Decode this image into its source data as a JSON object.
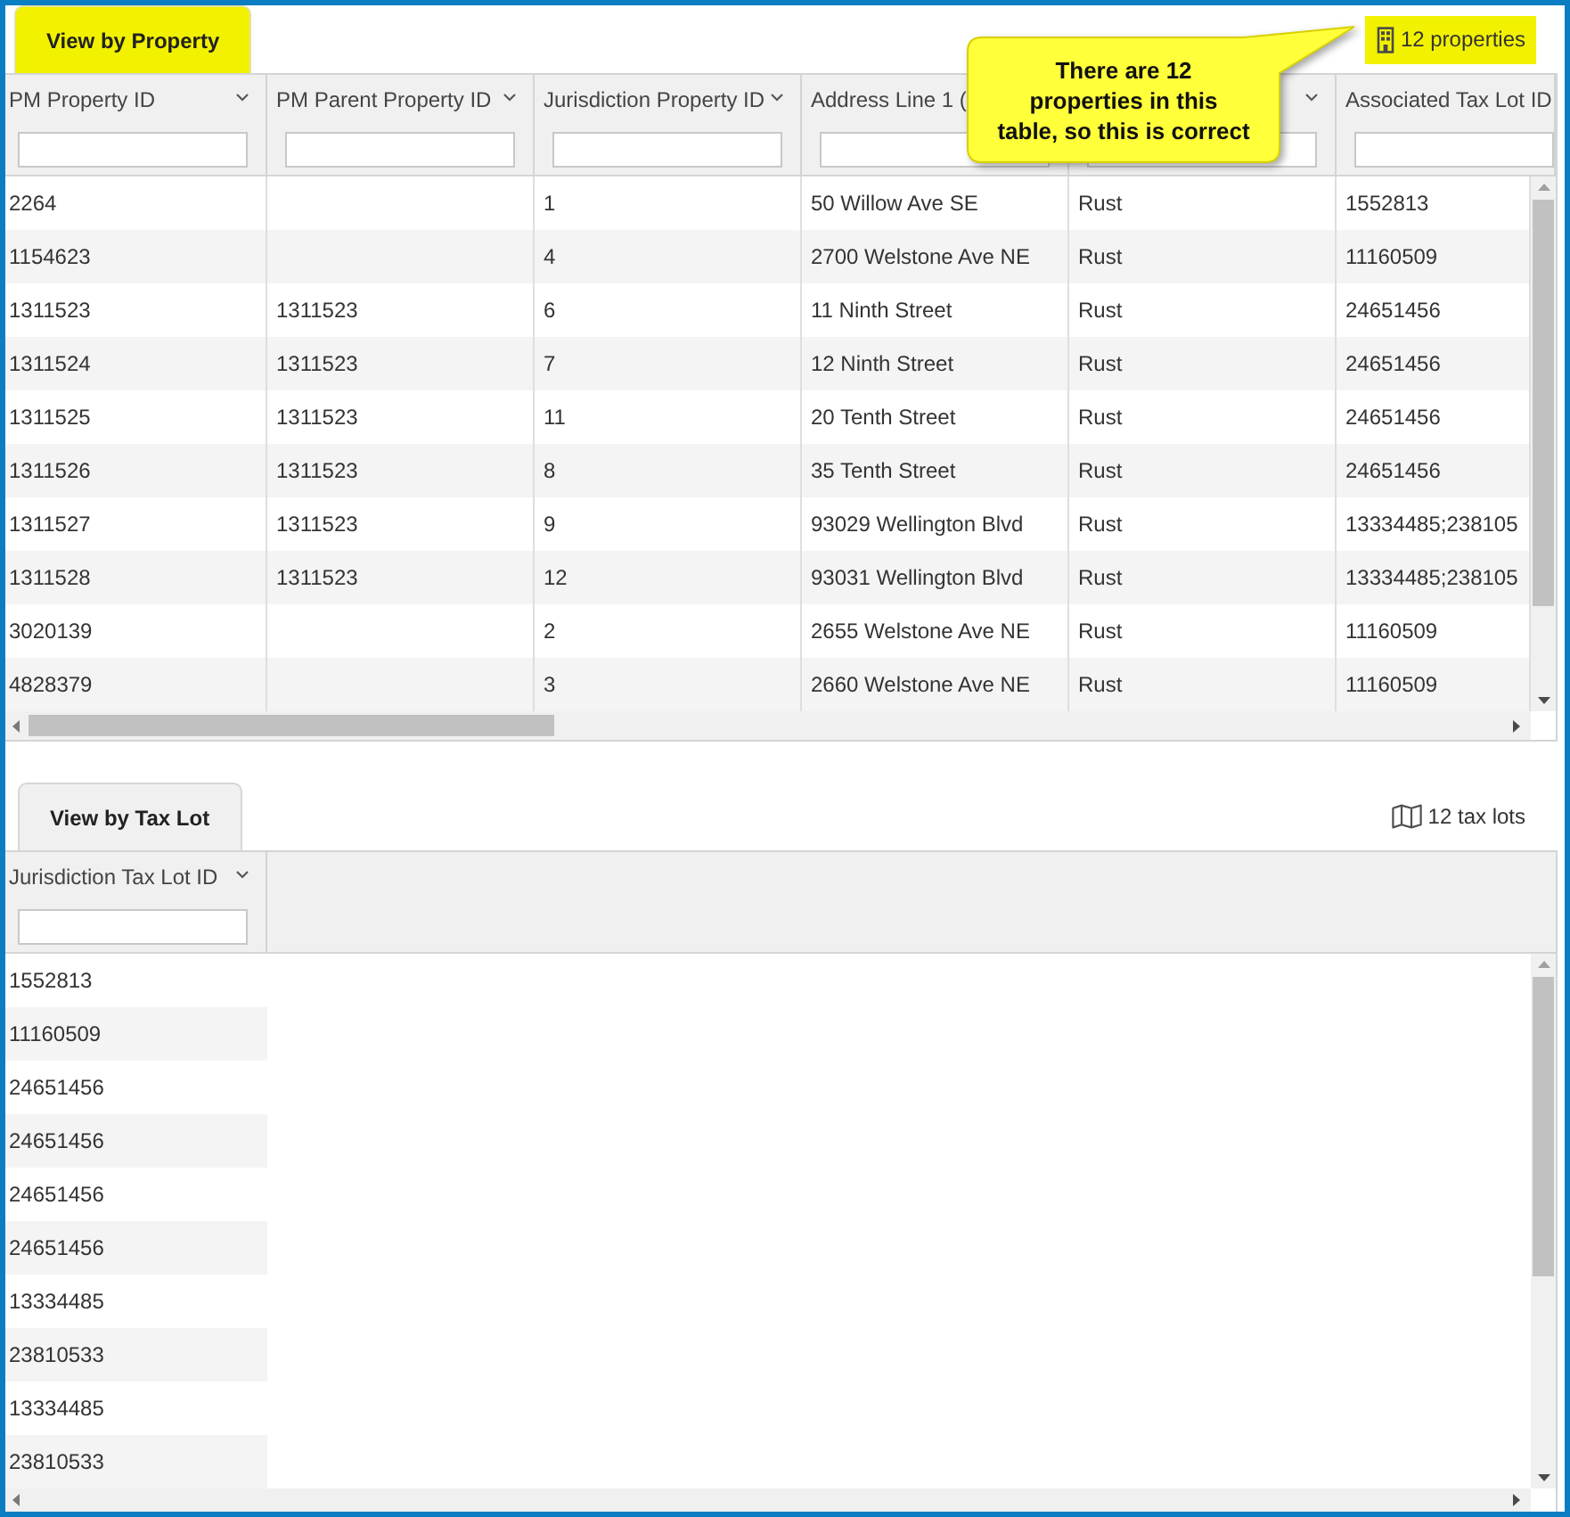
{
  "views": [
    {
      "kind": "property",
      "tab": {
        "label": "View by Property",
        "highlighted": true
      },
      "count": {
        "text": "12 properties",
        "highlighted": true
      },
      "table": {
        "columns": [
          {
            "label": "PM Property ID",
            "menu_icon": true
          },
          {
            "label": "PM Parent Property ID",
            "menu_icon": true
          },
          {
            "label": "Jurisdiction Property ID",
            "menu_icon": true
          },
          {
            "label": "Address Line 1 (",
            "menu_icon": false
          },
          {
            "menu_icon": true
          },
          {
            "label": "Associated Tax Lot ID",
            "menu_icon": false
          }
        ],
        "rows": [
          [
            "2264",
            null,
            "1",
            "50 Willow Ave SE",
            "Rust",
            "1552813"
          ],
          [
            "1154623",
            null,
            "4",
            "2700 Welstone Ave NE",
            "Rust",
            "11160509"
          ],
          [
            "1311523",
            "1311523",
            "6",
            "11 Ninth Street",
            "Rust",
            "24651456"
          ],
          [
            "1311524",
            "1311523",
            "7",
            "12 Ninth Street",
            "Rust",
            "24651456"
          ],
          [
            "1311525",
            "1311523",
            "11",
            "20 Tenth Street",
            "Rust",
            "24651456"
          ],
          [
            "1311526",
            "1311523",
            "8",
            "35 Tenth Street",
            "Rust",
            "24651456"
          ],
          [
            "1311527",
            "1311523",
            "9",
            "93029 Wellington Blvd",
            "Rust",
            "13334485;238105"
          ],
          [
            "1311528",
            "1311523",
            "12",
            "93031 Wellington Blvd",
            "Rust",
            "13334485;238105"
          ],
          [
            "3020139",
            null,
            "2",
            "2655 Welstone Ave NE",
            "Rust",
            "11160509"
          ],
          [
            "4828379",
            null,
            "3",
            "2660 Welstone Ave NE",
            "Rust",
            "11160509"
          ]
        ]
      }
    },
    {
      "kind": "tax_lot",
      "tab": {
        "label": "View by Tax Lot",
        "highlighted": false
      },
      "count": {
        "text": "12 tax lots",
        "highlighted": false
      },
      "table": {
        "columns": [
          {
            "label": "Jurisdiction Tax Lot ID",
            "menu_icon": true
          }
        ],
        "rows": [
          [
            "1552813"
          ],
          [
            "11160509"
          ],
          [
            "24651456"
          ],
          [
            "24651456"
          ],
          [
            "24651456"
          ],
          [
            "24651456"
          ],
          [
            "13334485"
          ],
          [
            "23810533"
          ],
          [
            "13334485"
          ],
          [
            "23810533"
          ]
        ]
      }
    }
  ],
  "callout": {
    "text": "There are 12 properties in this table, so this is correct"
  }
}
